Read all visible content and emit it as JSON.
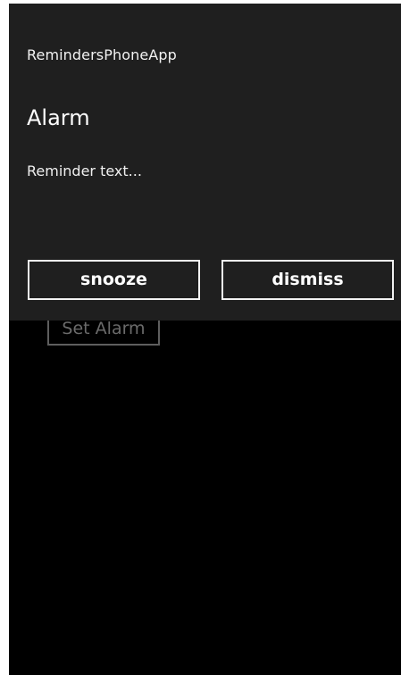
{
  "app": {
    "name": "RemindersPhoneApp"
  },
  "alarm": {
    "title": "Alarm",
    "content": "Reminder text...",
    "snooze_label": "snooze",
    "dismiss_label": "dismiss"
  },
  "background": {
    "set_alarm_label": "Set Alarm"
  },
  "colors": {
    "screen_bg": "#000000",
    "panel_bg": "#1f1f1f",
    "text": "#ffffff",
    "muted_border": "#5e5e5e"
  }
}
